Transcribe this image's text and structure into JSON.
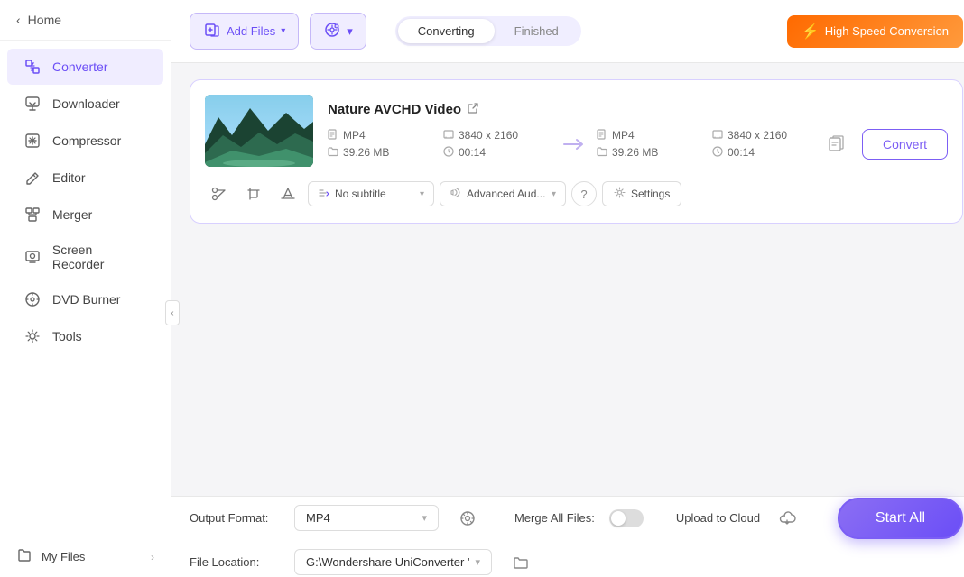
{
  "sidebar": {
    "home_label": "Home",
    "items": [
      {
        "id": "converter",
        "label": "Converter",
        "icon": "⬡",
        "active": true
      },
      {
        "id": "downloader",
        "label": "Downloader",
        "icon": "⬇"
      },
      {
        "id": "compressor",
        "label": "Compressor",
        "icon": "◈"
      },
      {
        "id": "editor",
        "label": "Editor",
        "icon": "✏"
      },
      {
        "id": "merger",
        "label": "Merger",
        "icon": "⊞"
      },
      {
        "id": "screen-recorder",
        "label": "Screen Recorder",
        "icon": "▣"
      },
      {
        "id": "dvd-burner",
        "label": "DVD Burner",
        "icon": "⊙"
      },
      {
        "id": "tools",
        "label": "Tools",
        "icon": "⚙"
      }
    ],
    "bottom_label": "My Files"
  },
  "topbar": {
    "add_file_label": "Add Files",
    "add_dvd_label": "Add DVD",
    "tab_converting": "Converting",
    "tab_finished": "Finished",
    "speed_label": "High Speed Conversion"
  },
  "file_card": {
    "title": "Nature AVCHD Video",
    "input": {
      "format": "MP4",
      "resolution": "3840 x 2160",
      "size": "39.26 MB",
      "duration": "00:14"
    },
    "output": {
      "format": "MP4",
      "resolution": "3840 x 2160",
      "size": "39.26 MB",
      "duration": "00:14"
    },
    "convert_btn": "Convert",
    "subtitle_label": "No subtitle",
    "audio_label": "Advanced Aud...",
    "settings_label": "Settings"
  },
  "bottom_bar": {
    "output_format_label": "Output Format:",
    "output_format_value": "MP4",
    "file_location_label": "File Location:",
    "file_location_value": "G:\\Wondershare UniConverter '",
    "merge_label": "Merge All Files:",
    "upload_label": "Upload to Cloud",
    "start_all_label": "Start All"
  }
}
